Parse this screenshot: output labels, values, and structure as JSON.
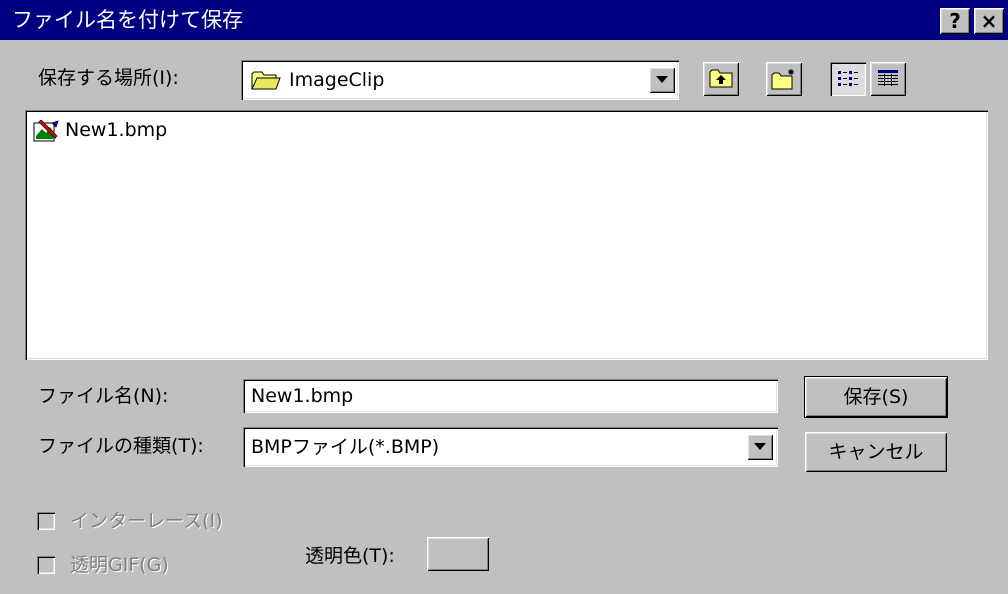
{
  "window": {
    "title": "ファイル名を付けて保存",
    "help_label": "?",
    "close_label": "×"
  },
  "look_in": {
    "label": "保存する場所(I):",
    "folder_icon": "folder-icon",
    "value": "ImageClip"
  },
  "toolbar": {
    "icons": [
      "up-one-level-icon",
      "new-folder-icon",
      "list-view-icon",
      "details-view-icon"
    ]
  },
  "file_list": {
    "items": [
      {
        "name": "New1.bmp",
        "icon": "bitmap-file-icon"
      }
    ]
  },
  "filename": {
    "label": "ファイル名(N):",
    "value": "New1.bmp"
  },
  "filetype": {
    "label": "ファイルの種類(T):",
    "value": "BMPファイル(*.BMP)"
  },
  "buttons": {
    "save": "保存(S)",
    "cancel": "キャンセル"
  },
  "options": {
    "interlace": {
      "label": "インターレース(I)",
      "checked": false,
      "enabled": false
    },
    "transparent_gif": {
      "label": "透明GIF(G)",
      "checked": false,
      "enabled": false
    },
    "transparent_color": {
      "label": "透明色(T):"
    }
  },
  "colors": {
    "title_bar": "#000080",
    "face": "#c0c0c0",
    "disabled_text": "#808080"
  }
}
